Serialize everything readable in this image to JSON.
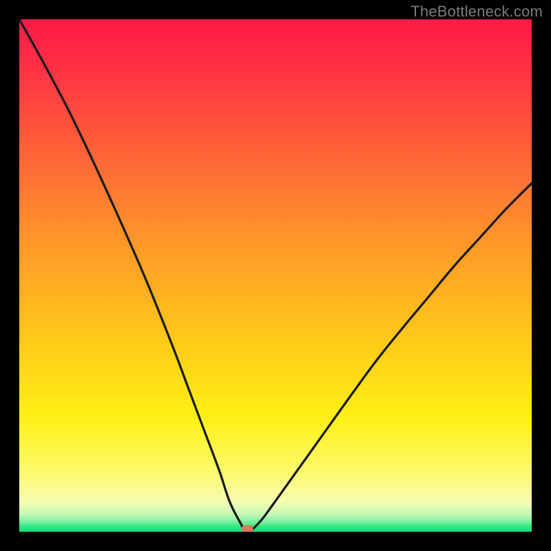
{
  "watermark": "TheBottleneck.com",
  "colors": {
    "frame": "#000000",
    "curve_stroke": "#1b1b1b",
    "marker_fill": "#e2785f"
  },
  "chart_data": {
    "type": "line",
    "title": "",
    "xlabel": "",
    "ylabel": "",
    "xlim": [
      0,
      100
    ],
    "ylim": [
      0,
      100
    ],
    "grid": false,
    "legend": false,
    "annotations": [
      "TheBottleneck.com"
    ],
    "series": [
      {
        "name": "bottleneck-curve",
        "x": [
          0,
          5,
          10,
          15,
          20,
          25,
          30,
          33,
          36,
          39,
          41,
          43,
          44.5,
          47,
          50,
          55,
          60,
          65,
          70,
          75,
          80,
          85,
          90,
          95,
          100
        ],
        "values": [
          100,
          91,
          81.5,
          71,
          60,
          48.5,
          36,
          28,
          20,
          12,
          6,
          2,
          0,
          2,
          6,
          13,
          20,
          27,
          33.8,
          40,
          46,
          52,
          57.5,
          63,
          68
        ]
      }
    ],
    "marker": {
      "x": 44.5,
      "y": 0.5
    }
  }
}
